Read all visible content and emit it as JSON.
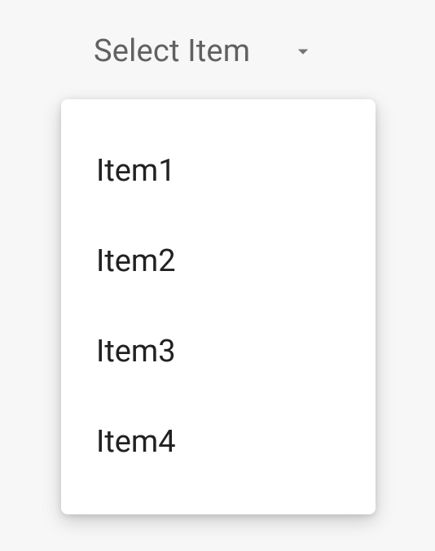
{
  "select": {
    "placeholder": "Select Item",
    "items": [
      {
        "label": "Item1"
      },
      {
        "label": "Item2"
      },
      {
        "label": "Item3"
      },
      {
        "label": "Item4"
      }
    ]
  }
}
